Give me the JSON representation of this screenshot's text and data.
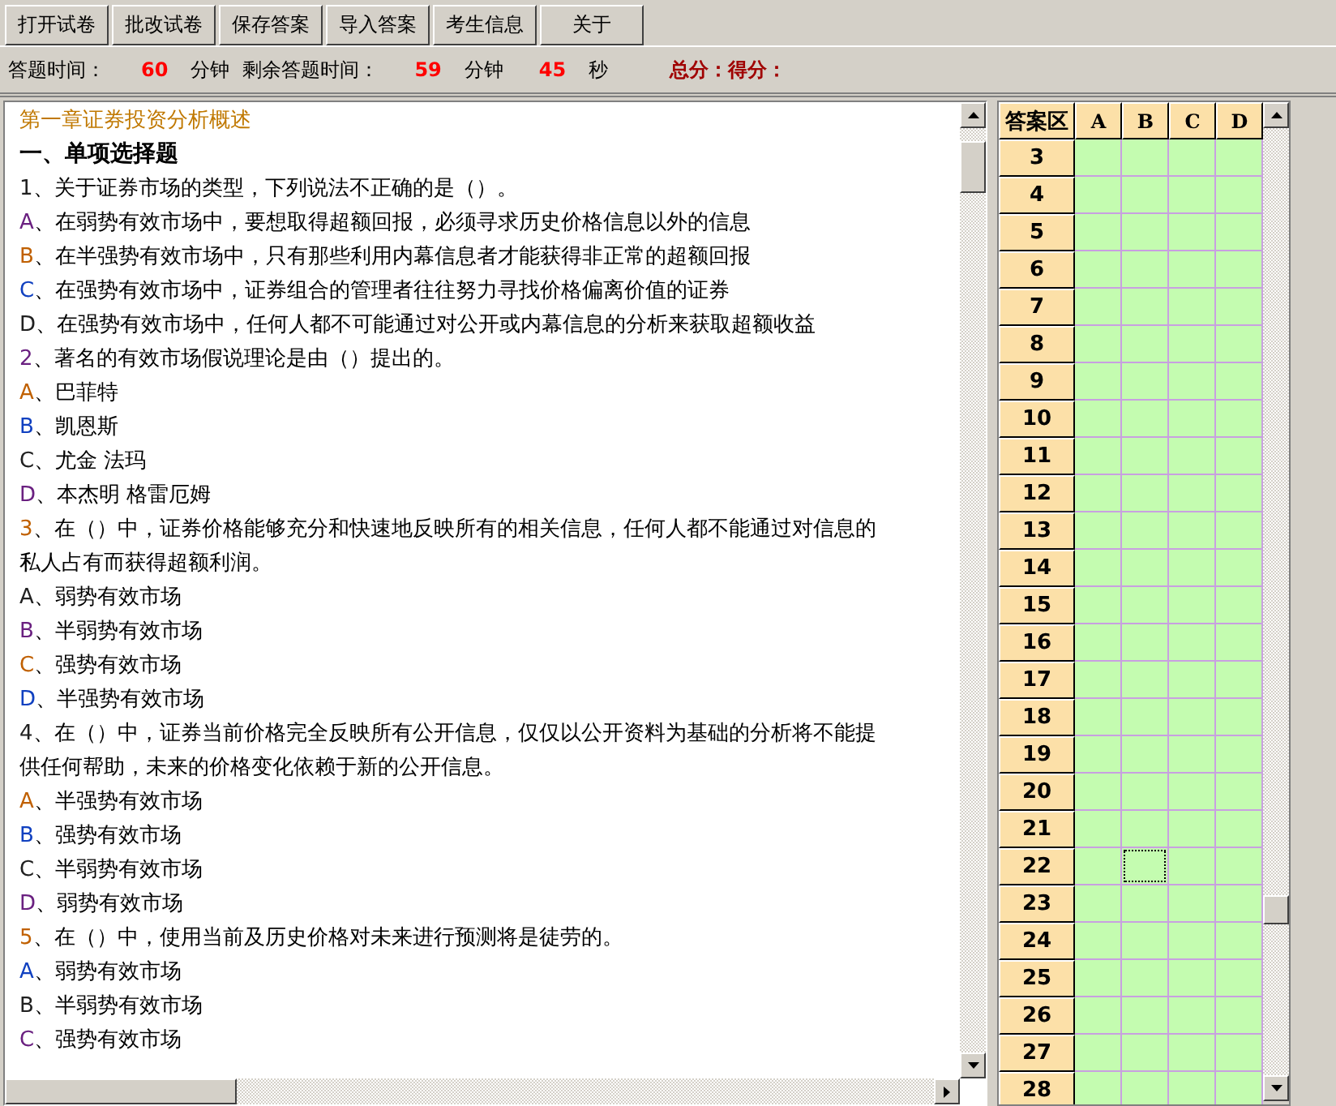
{
  "toolbar": {
    "buttons": [
      "打开试卷",
      "批改试卷",
      "保存答案",
      "导入答案",
      "考生信息",
      "关于"
    ]
  },
  "status": [
    {
      "kind": "label",
      "text": "答题时间："
    },
    {
      "kind": "value",
      "text": "60"
    },
    {
      "kind": "label",
      "text": "分钟"
    },
    {
      "kind": "label",
      "text": "剩余答题时间："
    },
    {
      "kind": "value",
      "text": "59"
    },
    {
      "kind": "label",
      "text": "分钟"
    },
    {
      "kind": "value",
      "text": "45"
    },
    {
      "kind": "label",
      "text": "秒"
    },
    {
      "kind": "score",
      "text": "总分：得分："
    }
  ],
  "document": {
    "lines": [
      {
        "kind": "chapter",
        "text": "第一章证券投资分析概述"
      },
      {
        "kind": "section",
        "text": "一、单项选择题"
      },
      {
        "kind": "item",
        "mark": "1",
        "text": "、关于证券市场的类型，下列说法不正确的是（）。"
      },
      {
        "kind": "item",
        "mark": "A",
        "text": "、在弱势有效市场中，要想取得超额回报，必须寻求历史价格信息以外的信息"
      },
      {
        "kind": "item",
        "mark": "B",
        "text": "、在半强势有效市场中，只有那些利用内幕信息者才能获得非正常的超额回报"
      },
      {
        "kind": "item",
        "mark": "C",
        "text": "、在强势有效市场中，证券组合的管理者往往努力寻找价格偏离价值的证券"
      },
      {
        "kind": "item",
        "mark": "D",
        "text": "、在强势有效市场中，任何人都不可能通过对公开或内幕信息的分析来获取超额收益"
      },
      {
        "kind": "item",
        "mark": "2",
        "text": "、著名的有效市场假说理论是由（）提出的。"
      },
      {
        "kind": "item",
        "mark": "A",
        "text": "、巴菲特"
      },
      {
        "kind": "item",
        "mark": "B",
        "text": "、凯恩斯"
      },
      {
        "kind": "item",
        "mark": "C",
        "text": "、尤金 法玛"
      },
      {
        "kind": "item",
        "mark": "D",
        "text": "、本杰明 格雷厄姆"
      },
      {
        "kind": "item",
        "mark": "3",
        "text": "、在（）中，证券价格能够充分和快速地反映所有的相关信息，任何人都不能通过对信息的"
      },
      {
        "kind": "plain",
        "text": "私人占有而获得超额利润。"
      },
      {
        "kind": "item",
        "mark": "A",
        "text": "、弱势有效市场"
      },
      {
        "kind": "item",
        "mark": "B",
        "text": "、半弱势有效市场"
      },
      {
        "kind": "item",
        "mark": "C",
        "text": "、强势有效市场"
      },
      {
        "kind": "item",
        "mark": "D",
        "text": "、半强势有效市场"
      },
      {
        "kind": "item",
        "mark": "4",
        "text": "、在（）中，证券当前价格完全反映所有公开信息，仅仅以公开资料为基础的分析将不能提"
      },
      {
        "kind": "plain",
        "text": "供任何帮助，未来的价格变化依赖于新的公开信息。"
      },
      {
        "kind": "item",
        "mark": "A",
        "text": "、半强势有效市场"
      },
      {
        "kind": "item",
        "mark": "B",
        "text": "、强势有效市场"
      },
      {
        "kind": "item",
        "mark": "C",
        "text": "、半弱势有效市场"
      },
      {
        "kind": "item",
        "mark": "D",
        "text": "、弱势有效市场"
      },
      {
        "kind": "item",
        "mark": "5",
        "text": "、在（）中，使用当前及历史价格对未来进行预测将是徒劳的。"
      },
      {
        "kind": "item",
        "mark": "A",
        "text": "、弱势有效市场"
      },
      {
        "kind": "item",
        "mark": "B",
        "text": "、半弱势有效市场"
      },
      {
        "kind": "item",
        "mark": "C",
        "text": "、强势有效市场"
      }
    ]
  },
  "answer_grid": {
    "columns": [
      "答案区",
      "A",
      "B",
      "C",
      "D"
    ],
    "rows": [
      {
        "label": "3",
        "cells": [
          {
            "focused": false
          },
          {
            "focused": false
          },
          {
            "focused": false
          },
          {
            "focused": false
          }
        ]
      },
      {
        "label": "4",
        "cells": [
          {
            "focused": false
          },
          {
            "focused": false
          },
          {
            "focused": false
          },
          {
            "focused": false
          }
        ]
      },
      {
        "label": "5",
        "cells": [
          {
            "focused": false
          },
          {
            "focused": false
          },
          {
            "focused": false
          },
          {
            "focused": false
          }
        ]
      },
      {
        "label": "6",
        "cells": [
          {
            "focused": false
          },
          {
            "focused": false
          },
          {
            "focused": false
          },
          {
            "focused": false
          }
        ]
      },
      {
        "label": "7",
        "cells": [
          {
            "focused": false
          },
          {
            "focused": false
          },
          {
            "focused": false
          },
          {
            "focused": false
          }
        ]
      },
      {
        "label": "8",
        "cells": [
          {
            "focused": false
          },
          {
            "focused": false
          },
          {
            "focused": false
          },
          {
            "focused": false
          }
        ]
      },
      {
        "label": "9",
        "cells": [
          {
            "focused": false
          },
          {
            "focused": false
          },
          {
            "focused": false
          },
          {
            "focused": false
          }
        ]
      },
      {
        "label": "10",
        "cells": [
          {
            "focused": false
          },
          {
            "focused": false
          },
          {
            "focused": false
          },
          {
            "focused": false
          }
        ]
      },
      {
        "label": "11",
        "cells": [
          {
            "focused": false
          },
          {
            "focused": false
          },
          {
            "focused": false
          },
          {
            "focused": false
          }
        ]
      },
      {
        "label": "12",
        "cells": [
          {
            "focused": false
          },
          {
            "focused": false
          },
          {
            "focused": false
          },
          {
            "focused": false
          }
        ]
      },
      {
        "label": "13",
        "cells": [
          {
            "focused": false
          },
          {
            "focused": false
          },
          {
            "focused": false
          },
          {
            "focused": false
          }
        ]
      },
      {
        "label": "14",
        "cells": [
          {
            "focused": false
          },
          {
            "focused": false
          },
          {
            "focused": false
          },
          {
            "focused": false
          }
        ]
      },
      {
        "label": "15",
        "cells": [
          {
            "focused": false
          },
          {
            "focused": false
          },
          {
            "focused": false
          },
          {
            "focused": false
          }
        ]
      },
      {
        "label": "16",
        "cells": [
          {
            "focused": false
          },
          {
            "focused": false
          },
          {
            "focused": false
          },
          {
            "focused": false
          }
        ]
      },
      {
        "label": "17",
        "cells": [
          {
            "focused": false
          },
          {
            "focused": false
          },
          {
            "focused": false
          },
          {
            "focused": false
          }
        ]
      },
      {
        "label": "18",
        "cells": [
          {
            "focused": false
          },
          {
            "focused": false
          },
          {
            "focused": false
          },
          {
            "focused": false
          }
        ]
      },
      {
        "label": "19",
        "cells": [
          {
            "focused": false
          },
          {
            "focused": false
          },
          {
            "focused": false
          },
          {
            "focused": false
          }
        ]
      },
      {
        "label": "20",
        "cells": [
          {
            "focused": false
          },
          {
            "focused": false
          },
          {
            "focused": false
          },
          {
            "focused": false
          }
        ]
      },
      {
        "label": "21",
        "cells": [
          {
            "focused": false
          },
          {
            "focused": false
          },
          {
            "focused": false
          },
          {
            "focused": false
          }
        ]
      },
      {
        "label": "22",
        "cells": [
          {
            "focused": false
          },
          {
            "focused": true
          },
          {
            "focused": false
          },
          {
            "focused": false
          }
        ]
      },
      {
        "label": "23",
        "cells": [
          {
            "focused": false
          },
          {
            "focused": false
          },
          {
            "focused": false
          },
          {
            "focused": false
          }
        ]
      },
      {
        "label": "24",
        "cells": [
          {
            "focused": false
          },
          {
            "focused": false
          },
          {
            "focused": false
          },
          {
            "focused": false
          }
        ]
      },
      {
        "label": "25",
        "cells": [
          {
            "focused": false
          },
          {
            "focused": false
          },
          {
            "focused": false
          },
          {
            "focused": false
          }
        ]
      },
      {
        "label": "26",
        "cells": [
          {
            "focused": false
          },
          {
            "focused": false
          },
          {
            "focused": false
          },
          {
            "focused": false
          }
        ]
      },
      {
        "label": "27",
        "cells": [
          {
            "focused": false
          },
          {
            "focused": false
          },
          {
            "focused": false
          },
          {
            "focused": false
          }
        ]
      },
      {
        "label": "28",
        "cells": [
          {
            "focused": false
          },
          {
            "focused": false
          },
          {
            "focused": false
          },
          {
            "focused": false
          }
        ]
      }
    ]
  }
}
